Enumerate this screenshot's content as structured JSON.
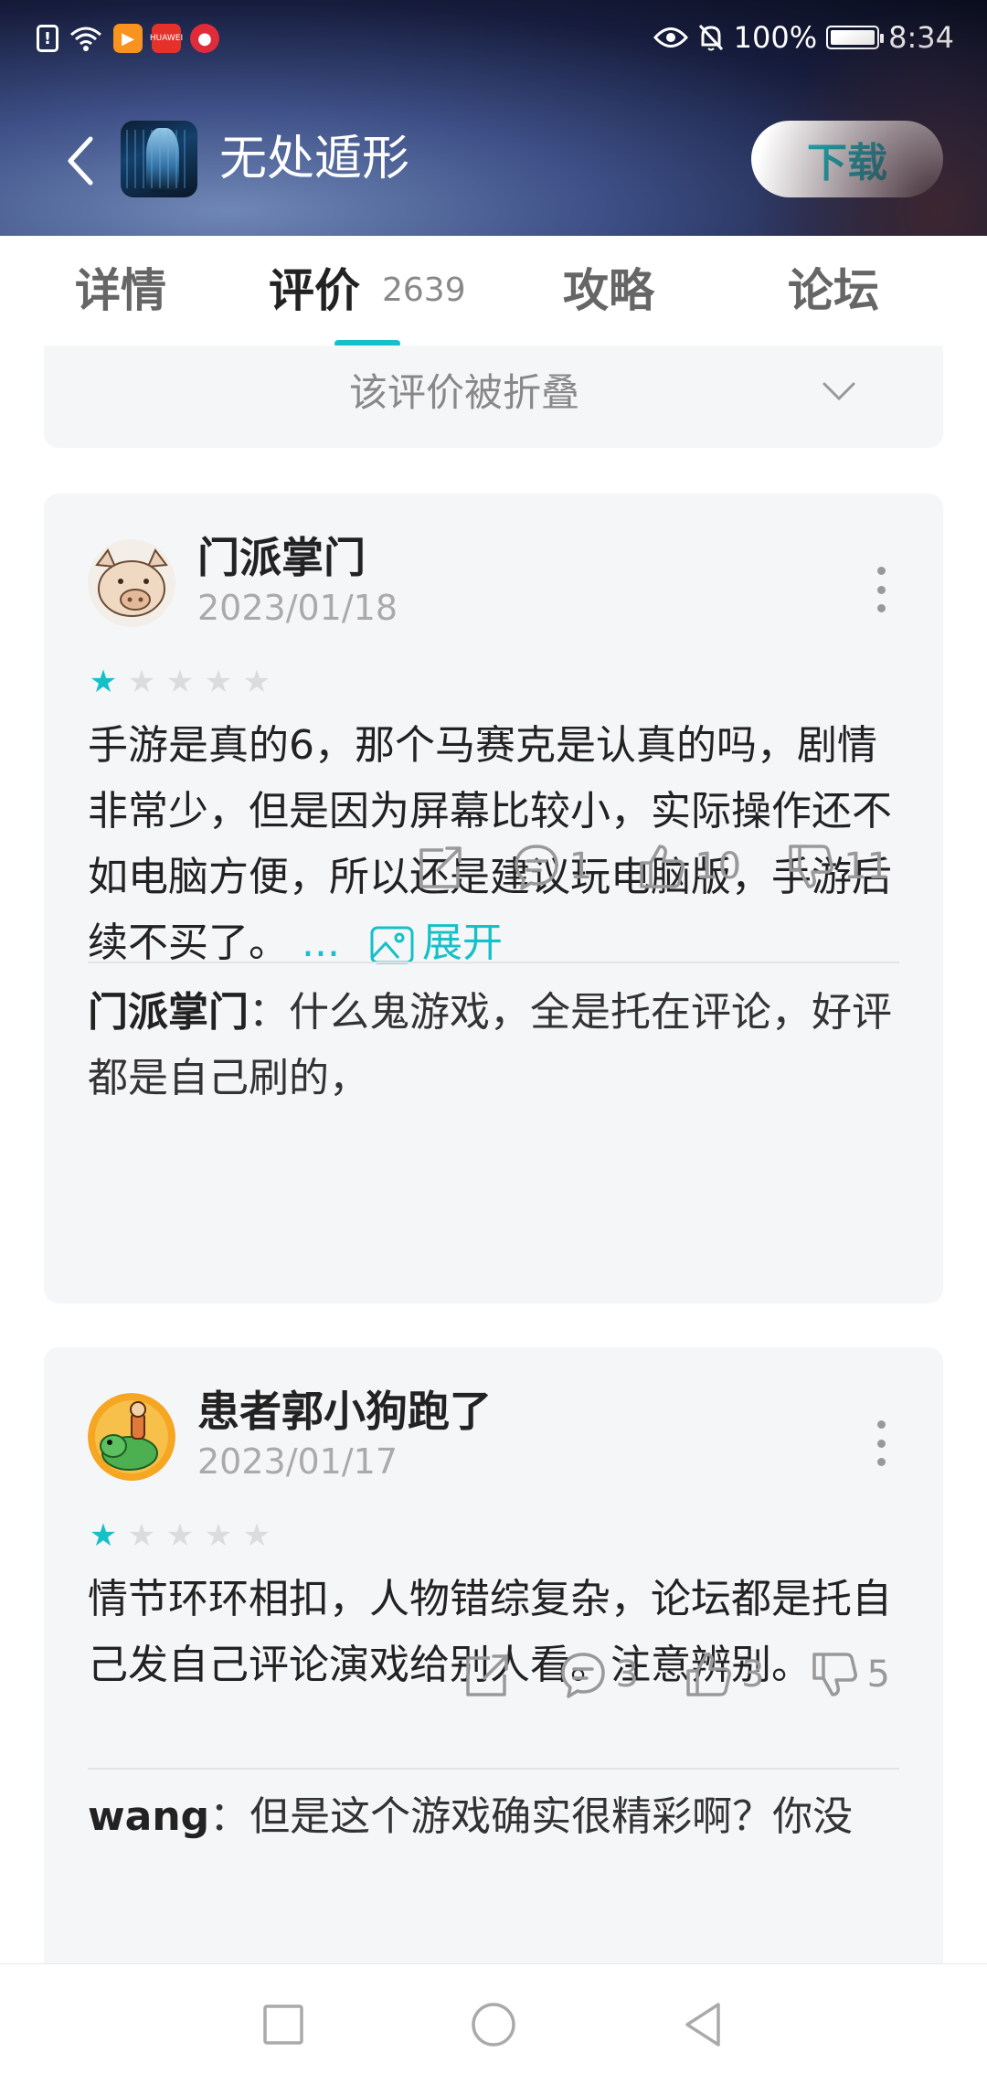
{
  "status_bar": {
    "battery_percent": "100%",
    "time": "8:34",
    "left_icons": [
      "alert-icon",
      "wifi-icon",
      "video-app-icon",
      "huawei-app-icon",
      "red-app-icon"
    ],
    "huawei_label": "HUAWEI"
  },
  "header": {
    "app_title": "无处遁形",
    "download_label": "下载"
  },
  "tabs": [
    {
      "label": "详情"
    },
    {
      "label": "评价",
      "count": "2639",
      "active": true
    },
    {
      "label": "攻略"
    },
    {
      "label": "论坛"
    }
  ],
  "folded_review": {
    "text": "该评价被折叠"
  },
  "reviews": [
    {
      "username": "门派掌门",
      "date": "2023/01/18",
      "rating": 1,
      "text": "手游是真的6，那个马赛克是认真的吗，剧情非常少，但是因为屏幕比较小，实际操作还不如电脑方便，所以还是建议玩电脑版，手游后续不买了。",
      "ellipsis": "...",
      "expand_label": "展开",
      "comments": "1",
      "likes": "10",
      "dislikes": "11",
      "reply": {
        "author": "门派掌门",
        "separator": "：",
        "text": "什么鬼游戏，全是托在评论，好评都是自己刷的，"
      }
    },
    {
      "username": "患者郭小狗跑了",
      "date": "2023/01/17",
      "rating": 1,
      "text": "情节环环相扣，人物错综复杂，论坛都是托自己发自己评论演戏给别人看。注意辨别。",
      "comments": "3",
      "likes": "3",
      "dislikes": "5",
      "reply": {
        "author": "wang",
        "separator": "：",
        "text": "但是这个游戏确实很精彩啊？你没"
      }
    }
  ],
  "colors": {
    "accent": "#15c0c8",
    "card_bg": "#f5f6f8",
    "muted_text": "#aaaaaa"
  }
}
